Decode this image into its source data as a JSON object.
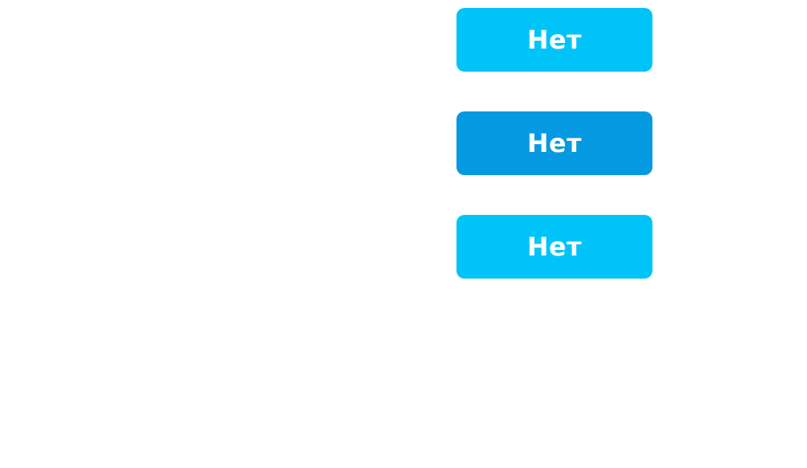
{
  "buttons": [
    {
      "label": "Нет",
      "state": "normal",
      "color": "#00C4F8"
    },
    {
      "label": "Нет",
      "state": "hover",
      "color": "#0499E0"
    },
    {
      "label": "Нет",
      "state": "normal",
      "color": "#00C4F8"
    }
  ]
}
